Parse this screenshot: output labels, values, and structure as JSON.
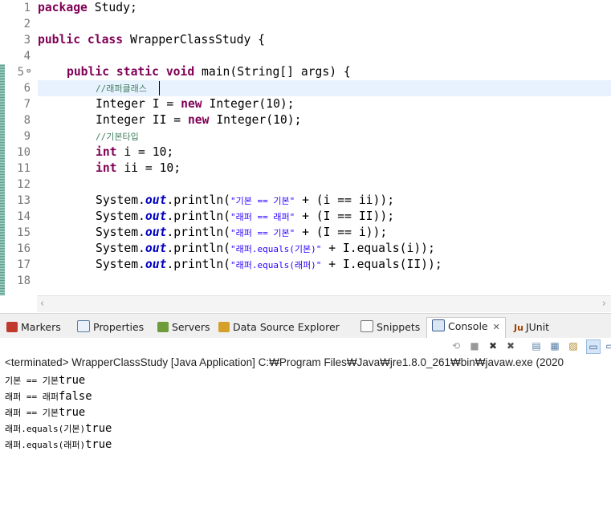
{
  "editor": {
    "line_numbers": [
      "1",
      "2",
      "3",
      "4",
      "5",
      "6",
      "7",
      "8",
      "9",
      "10",
      "11",
      "12",
      "13",
      "14",
      "15",
      "16",
      "17",
      "18"
    ],
    "fold_marker": "⊖",
    "lines": {
      "l1": {
        "kw": "package",
        "rest": " Study;"
      },
      "l3": {
        "kw1": "public",
        "kw2": "class",
        "rest": " WrapperClassStudy {"
      },
      "l5": {
        "kw1": "public",
        "kw2": "static",
        "kw3": "void",
        "rest": " main(String[] args) {"
      },
      "l6": {
        "comment": "//래퍼클래스"
      },
      "l7": {
        "a": "Integer I = ",
        "kw": "new",
        "b": " Integer(10);"
      },
      "l8": {
        "a": "Integer II = ",
        "kw": "new",
        "b": " Integer(10);"
      },
      "l9": {
        "comment": "//기본타입"
      },
      "l10": {
        "kw": "int",
        "rest": " i = 10;"
      },
      "l11": {
        "kw": "int",
        "rest": " ii = 10;"
      },
      "l13": {
        "pre": "System.",
        "fld": "out",
        "mid": ".println(",
        "str": "\"기본 == 기본\"",
        "post": " + (i == ii));"
      },
      "l14": {
        "pre": "System.",
        "fld": "out",
        "mid": ".println(",
        "str": "\"래퍼 == 래퍼\"",
        "post": " + (I == II));"
      },
      "l15": {
        "pre": "System.",
        "fld": "out",
        "mid": ".println(",
        "str": "\"래퍼 == 기본\"",
        "post": " + (I == i));"
      },
      "l16": {
        "pre": "System.",
        "fld": "out",
        "mid": ".println(",
        "str": "\"래퍼.equals(기본)\"",
        "post": " + I.equals(i));"
      },
      "l17": {
        "pre": "System.",
        "fld": "out",
        "mid": ".println(",
        "str": "\"래퍼.equals(래퍼)\"",
        "post": " + I.equals(II));"
      }
    }
  },
  "scroll": {
    "left_icon": "‹",
    "right_icon": "›"
  },
  "views": {
    "tabs": [
      {
        "label": "Markers",
        "icon": "markers-icon"
      },
      {
        "label": "Properties",
        "icon": "properties-icon"
      },
      {
        "label": "Servers",
        "icon": "servers-icon"
      },
      {
        "label": "Data Source Explorer",
        "icon": "data-source-icon"
      },
      {
        "label": "Snippets",
        "icon": "snippets-icon"
      },
      {
        "label": "Console",
        "icon": "console-icon",
        "active": true
      },
      {
        "label": "JUnit",
        "icon": "junit-icon"
      }
    ],
    "close_glyph": "✕",
    "junit_prefix": "Ju"
  },
  "console": {
    "header": "<terminated> WrapperClassStudy [Java Application] C:₩Program Files₩Java₩jre1.8.0_261₩bin₩javaw.exe  (2020",
    "output": [
      {
        "ko": "기본 == 기본",
        "val": "true"
      },
      {
        "ko": "래퍼 == 래퍼",
        "val": "false"
      },
      {
        "ko": "래퍼 == 기본",
        "val": "true"
      },
      {
        "ko": "래퍼.equals(기본)",
        "val": "true"
      },
      {
        "ko": "래퍼.equals(래퍼)",
        "val": "true"
      }
    ]
  },
  "colors": {
    "keyword": "#7f0055",
    "comment": "#3f7f5f",
    "string": "#2a00ff",
    "field": "#0000c0",
    "current_line": "#e8f2fe"
  }
}
